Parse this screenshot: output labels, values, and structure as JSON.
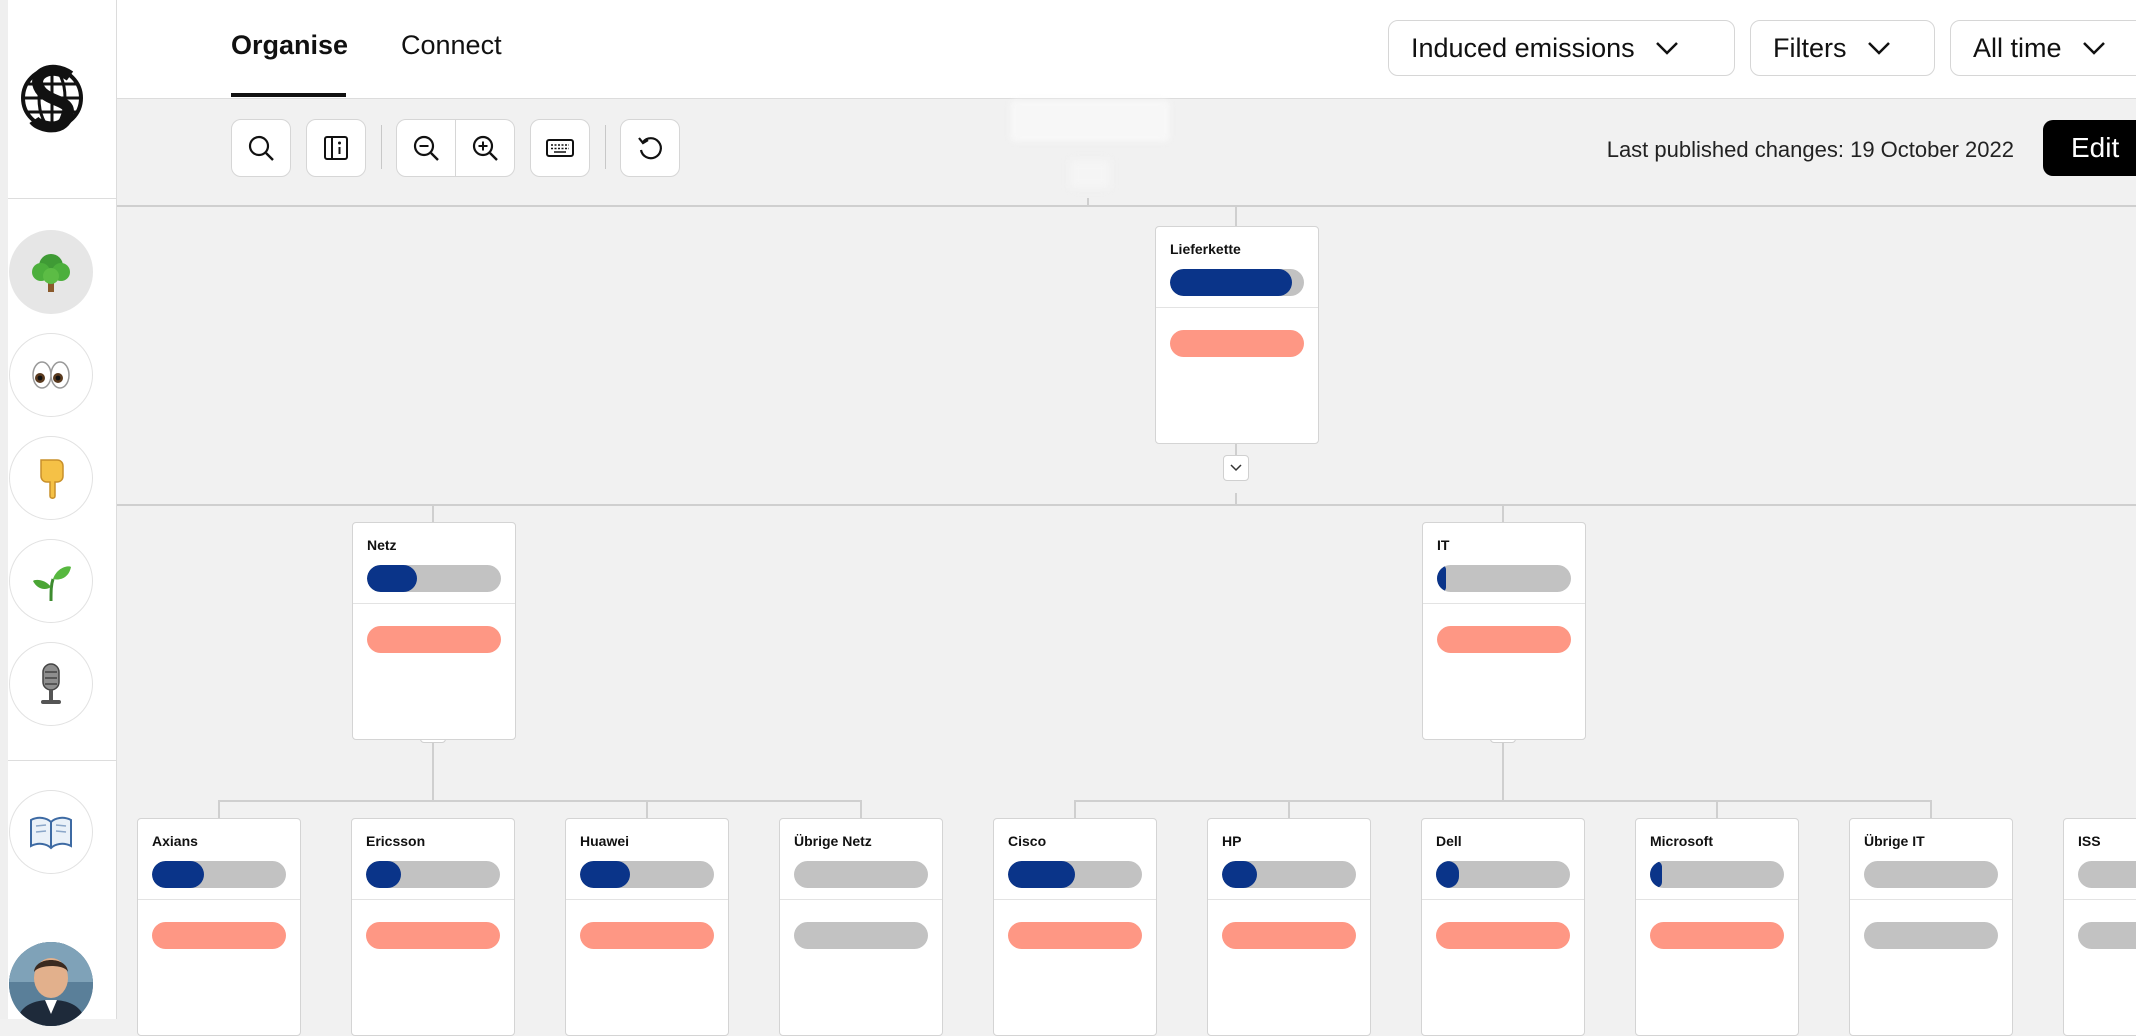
{
  "tabs": [
    {
      "label": "Organise",
      "active": true
    },
    {
      "label": "Connect",
      "active": false
    }
  ],
  "filters": {
    "metric": "Induced emissions",
    "filters_label": "Filters",
    "time_range": "All time"
  },
  "toolbar": {
    "tools": [
      "search-icon",
      "info-panel-icon",
      "zoom-out-icon",
      "zoom-in-icon",
      "keyboard-icon",
      "reset-icon"
    ],
    "published_text": "Last published changes: 19 October 2022",
    "edit_label": "Edit"
  },
  "sidebar": {
    "items": [
      {
        "icon": "tree-icon",
        "active": true
      },
      {
        "icon": "eyes-icon",
        "active": false
      },
      {
        "icon": "pointing-hand-icon",
        "active": false
      },
      {
        "icon": "seedling-icon",
        "active": false
      },
      {
        "icon": "microphone-icon",
        "active": false
      },
      {
        "icon": "book-icon",
        "active": false
      }
    ]
  },
  "colors": {
    "bar_primary": "#0a3489",
    "bar_track": "#c2c2c2",
    "bar_secondary": "#fe9784",
    "bar_empty": "#c2c2c2"
  },
  "tree": {
    "root": {
      "label": "Lieferkette",
      "fill": 0.91,
      "secondary": "salmon"
    },
    "level1": [
      {
        "label": "Netz",
        "fill": 0.37,
        "secondary": "salmon"
      },
      {
        "label": "IT",
        "fill": 0.07,
        "secondary": "salmon"
      }
    ],
    "level2": [
      {
        "label": "Axians",
        "fill": 0.39,
        "secondary": "salmon"
      },
      {
        "label": "Ericsson",
        "fill": 0.26,
        "secondary": "salmon"
      },
      {
        "label": "Huawei",
        "fill": 0.37,
        "secondary": "salmon"
      },
      {
        "label": "Übrige Netz",
        "fill": 0.0,
        "secondary": "grey"
      },
      {
        "label": "Cisco",
        "fill": 0.5,
        "secondary": "salmon"
      },
      {
        "label": "HP",
        "fill": 0.26,
        "secondary": "salmon"
      },
      {
        "label": "Dell",
        "fill": 0.17,
        "secondary": "salmon"
      },
      {
        "label": "Microsoft",
        "fill": 0.09,
        "secondary": "salmon"
      },
      {
        "label": "Übrige IT",
        "fill": 0.0,
        "secondary": "grey"
      },
      {
        "label": "ISS",
        "fill": 0.0,
        "secondary": "grey"
      }
    ]
  }
}
